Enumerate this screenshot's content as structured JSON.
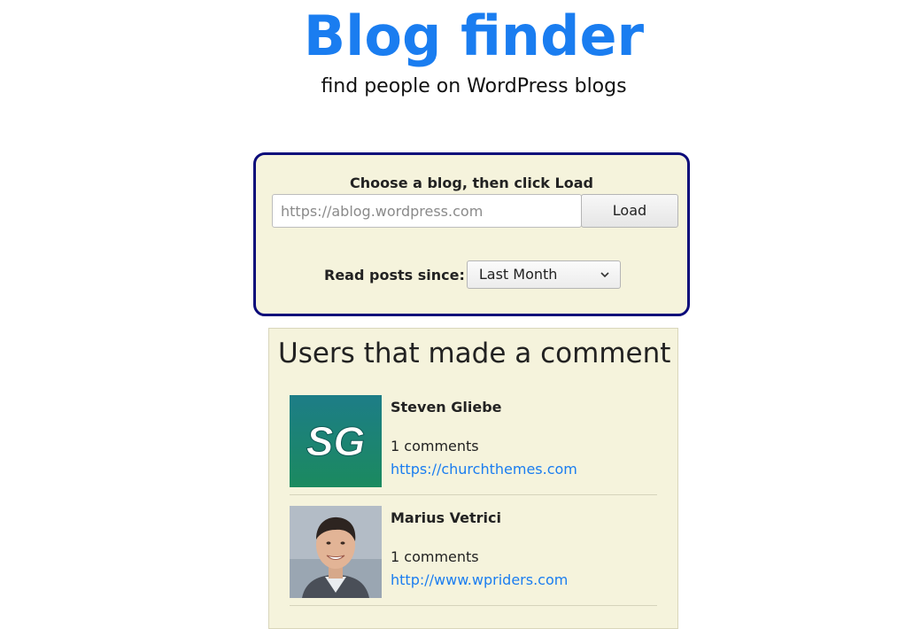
{
  "header": {
    "title": "Blog finder",
    "subtitle": "find people on WordPress blogs"
  },
  "chooser": {
    "label": "Choose a blog, then click Load",
    "url_placeholder": "https://ablog.wordpress.com",
    "url_value": "",
    "load_label": "Load",
    "since_label": "Read posts since:",
    "since_selected": "Last Month"
  },
  "users": {
    "heading": "Users that made a comment",
    "items": [
      {
        "name": "Steven Gliebe",
        "comments": "1 comments",
        "url": "https://churchthemes.com",
        "avatar_text": "SG",
        "avatar_icon": "sg-logo-avatar"
      },
      {
        "name": "Marius Vetrici",
        "comments": "1 comments",
        "url": "http://www.wpriders.com",
        "avatar_icon": "person-photo-avatar"
      }
    ]
  },
  "colors": {
    "accent": "#1a7df0",
    "panel_bg": "#f5f3dc",
    "chooser_border": "#0b0b7a"
  }
}
